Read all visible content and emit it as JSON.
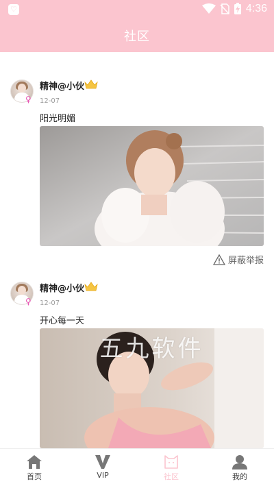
{
  "status_bar": {
    "time": "4:36"
  },
  "header": {
    "title": "社区"
  },
  "posts": [
    {
      "username": "精神@小伙",
      "date": "12-07",
      "text": "阳光明媚",
      "report_label": "屏蔽举报"
    },
    {
      "username": "精神@小伙",
      "date": "12-07",
      "text": "开心每一天",
      "watermark": "五九软件"
    }
  ],
  "tabbar": {
    "items": [
      {
        "label": "首页",
        "icon": "home-icon"
      },
      {
        "label": "VIP",
        "icon": "vip-icon"
      },
      {
        "label": "社区",
        "icon": "community-icon",
        "active": true
      },
      {
        "label": "我的",
        "icon": "profile-icon"
      }
    ]
  },
  "colors": {
    "primary": "#fbc5cf",
    "female": "#e854b3",
    "crown": "#f5c542"
  }
}
